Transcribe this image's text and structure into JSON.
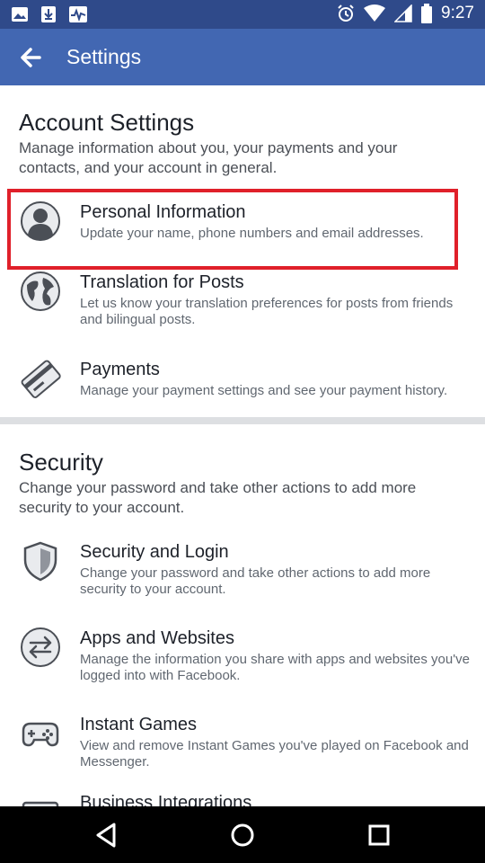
{
  "status_bar": {
    "time": "9:27",
    "left_icons": [
      "image-icon",
      "download-icon",
      "activity-icon"
    ],
    "right_icons": [
      "alarm-icon",
      "wifi-icon",
      "signal-icon",
      "battery-icon"
    ]
  },
  "app_bar": {
    "title": "Settings",
    "back_icon": "arrow-left-icon",
    "background": "#4267b2"
  },
  "account": {
    "title": "Account Settings",
    "description": "Manage information about you, your payments and your contacts, and your account in general.",
    "items": [
      {
        "icon": "person-icon",
        "title": "Personal Information",
        "description": "Update your name, phone numbers and email addresses."
      },
      {
        "icon": "globe-icon",
        "title": "Translation for Posts",
        "description": "Let us know your translation preferences for posts from friends and bilingual posts."
      },
      {
        "icon": "credit-card-icon",
        "title": "Payments",
        "description": "Manage your payment settings and see your payment history."
      }
    ]
  },
  "security": {
    "title": "Security",
    "description": "Change your password and take other actions to add more security to your account.",
    "items": [
      {
        "icon": "shield-icon",
        "title": "Security and Login",
        "description": "Change your password and take other actions to add more security to your account."
      },
      {
        "icon": "swap-arrows-icon",
        "title": "Apps and Websites",
        "description": "Manage the information you share with apps and websites you've logged into with Facebook."
      },
      {
        "icon": "gamepad-icon",
        "title": "Instant Games",
        "description": "View and remove Instant Games you've played on Facebook and Messenger."
      },
      {
        "icon": "business-icon",
        "title": "Business Integrations",
        "description": ""
      }
    ]
  },
  "highlight_color": "#e0202a",
  "nav_bar": {
    "buttons": [
      "back-triangle-icon",
      "home-circle-icon",
      "recents-square-icon"
    ]
  }
}
